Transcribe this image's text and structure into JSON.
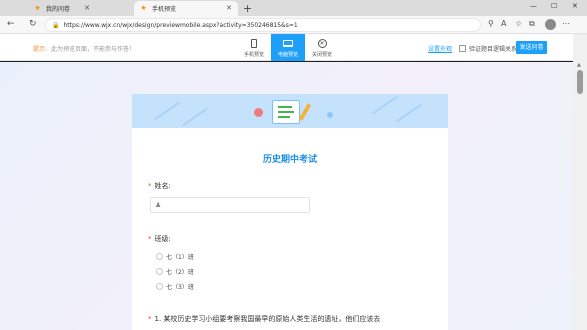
{
  "browser": {
    "tabs": [
      {
        "label": "我的问卷"
      },
      {
        "label": "手机预览"
      }
    ],
    "url": "https://www.wjx.cn/wjx/design/previewmobile.aspx?activity=350246815&s=1"
  },
  "toolbar": {
    "tip_label": "提示:",
    "tip_text": "此为预览页面，不能参与作答！",
    "modes": [
      {
        "label": "手机预览",
        "icon": "phone-icon"
      },
      {
        "label": "电脑预览",
        "icon": "monitor-icon"
      },
      {
        "label": "关闭预览",
        "icon": "close-icon"
      }
    ],
    "settings_link": "设置外观",
    "checkbox_label": "验证题目逻辑关系",
    "send_button": "发送问卷"
  },
  "survey": {
    "title": "历史期中考试",
    "questions": [
      {
        "label": "姓名:",
        "required": true,
        "type": "text"
      },
      {
        "label": "班级:",
        "required": true,
        "type": "radio",
        "options": [
          "七（1）班",
          "七（2）班",
          "七（3）班"
        ]
      },
      {
        "label": "1. 某校历史学习小组要考察我国最早的原始人类生活的遗址，他们应该去",
        "required": true
      }
    ]
  },
  "colors": {
    "accent": "#1ea0fa",
    "title": "#1e90e6",
    "required": "#e74c3c",
    "tip": "#f08c2a"
  }
}
